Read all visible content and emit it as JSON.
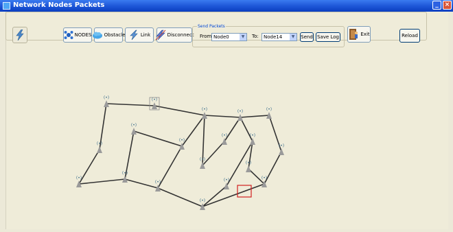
{
  "window": {
    "title": "Network Nodes Packets"
  },
  "toolbar": {
    "nodes_label": "NODES",
    "obstacle_label": "Obstacle",
    "link_label": "Link",
    "disconnect_label": "Disconnect",
    "exit_label": "Exit",
    "reload_label": "Reload"
  },
  "send_packets": {
    "group_label": "Send Packets",
    "from_label": "From:",
    "from_value": "Node0",
    "to_label": "To:",
    "to_value": "Node14",
    "send_label": "Send",
    "save_log_label": "Save Log"
  },
  "icons": {
    "app": "network-icon",
    "main_tool": "lightning-icon",
    "nodes": "nodes-icon",
    "obstacle": "cloud-icon",
    "link": "link-icon",
    "disconnect": "disconnect-icon",
    "exit": "exit-icon",
    "node": "antenna-node-icon"
  },
  "colors": {
    "title_bar": "#1c55d6",
    "background": "#efecd9",
    "link_line": "#333333",
    "node": "#9a9a9a",
    "node_signal": "#3c6e8c",
    "selection": "#d11f1f"
  }
}
